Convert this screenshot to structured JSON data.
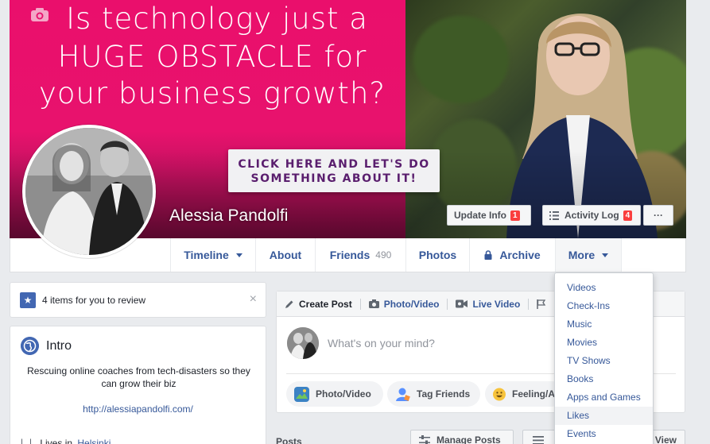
{
  "cover": {
    "headline_line1": "Is technology just a",
    "headline_line2": "HUGE OBSTACLE for",
    "headline_line3": "your business growth?",
    "cta_line1": "CLICK HERE AND LET'S DO",
    "cta_line2": "SOMETHING ABOUT IT!"
  },
  "profile": {
    "name": "Alessia Pandolfi"
  },
  "actions": {
    "update_info_label": "Update Info",
    "update_info_count": "1",
    "activity_log_label": "Activity Log",
    "activity_log_count": "4",
    "more_dots": "···"
  },
  "nav": {
    "tabs": [
      {
        "label": "Timeline"
      },
      {
        "label": "About"
      },
      {
        "label": "Friends",
        "count": "490"
      },
      {
        "label": "Photos"
      },
      {
        "label": "Archive"
      },
      {
        "label": "More"
      }
    ]
  },
  "review": {
    "text": "4 items for you to review",
    "close": "×"
  },
  "intro": {
    "title": "Intro",
    "bio": "Rescuing online coaches from tech-disasters so they can grow their biz",
    "link": "http://alessiapandolfi.com/",
    "lives_in_prefix": "Lives in",
    "lives_in_city": "Helsinki"
  },
  "composer": {
    "tabs": [
      "Create Post",
      "Photo/Video",
      "Live Video"
    ],
    "placeholder": "What's on your mind?",
    "pills": [
      "Photo/Video",
      "Tag Friends",
      "Feeling/A"
    ]
  },
  "posts": {
    "label": "Posts",
    "manage_label": "Manage Posts",
    "view_label": "View"
  },
  "more_menu": {
    "items": [
      "Videos",
      "Check-Ins",
      "Music",
      "Movies",
      "TV Shows",
      "Books",
      "Apps and Games",
      "Likes",
      "Events"
    ]
  },
  "colors": {
    "cover_pink": "#e8126d",
    "link_blue": "#365899",
    "badge_red": "#fa3e3e"
  }
}
